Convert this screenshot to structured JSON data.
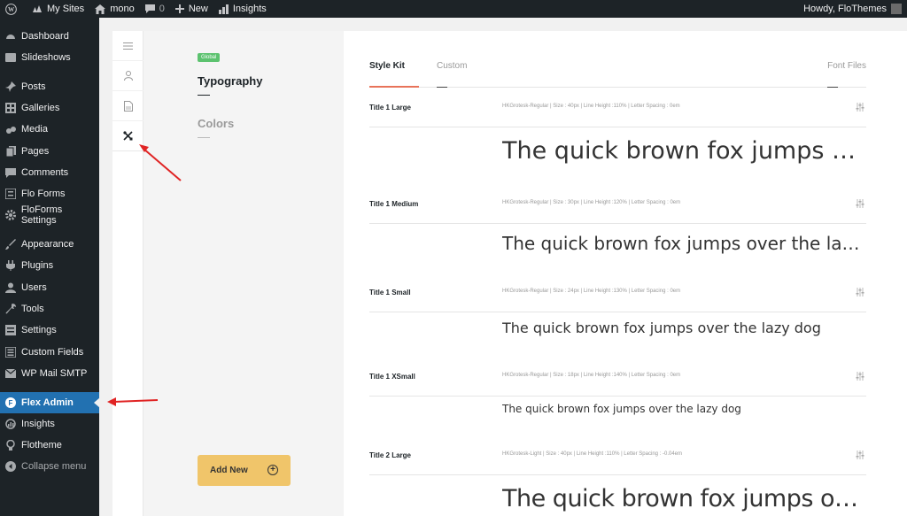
{
  "admin_bar": {
    "my_sites": "My Sites",
    "site_name": "mono",
    "comments_count": "0",
    "new_label": "New",
    "insights_label": "Insights",
    "howdy": "Howdy, FloThemes"
  },
  "sidebar": {
    "items": [
      {
        "label": "Dashboard",
        "icon": "dashboard-icon"
      },
      {
        "label": "Slideshows",
        "icon": "slideshows-icon"
      },
      {
        "label": "Posts",
        "icon": "pin-icon"
      },
      {
        "label": "Galleries",
        "icon": "galleries-icon"
      },
      {
        "label": "Media",
        "icon": "media-icon"
      },
      {
        "label": "Pages",
        "icon": "pages-icon"
      },
      {
        "label": "Comments",
        "icon": "comment-icon"
      },
      {
        "label": "Flo Forms",
        "icon": "form-icon"
      },
      {
        "label": "FloForms Settings",
        "icon": "gear-icon"
      },
      {
        "label": "Appearance",
        "icon": "brush-icon"
      },
      {
        "label": "Plugins",
        "icon": "plug-icon"
      },
      {
        "label": "Users",
        "icon": "user-icon"
      },
      {
        "label": "Tools",
        "icon": "wrench-icon"
      },
      {
        "label": "Settings",
        "icon": "settings-icon"
      },
      {
        "label": "Custom Fields",
        "icon": "fields-icon"
      },
      {
        "label": "WP Mail SMTP",
        "icon": "mail-icon"
      },
      {
        "label": "Flex Admin",
        "icon": "flex-icon",
        "active": true
      },
      {
        "label": "Insights",
        "icon": "insights-icon"
      },
      {
        "label": "Flotheme",
        "icon": "bulb-icon"
      },
      {
        "label": "Collapse menu",
        "icon": "collapse-icon"
      }
    ]
  },
  "panel": {
    "badge": "Global",
    "categories": [
      "Typography",
      "Colors"
    ],
    "add_new": "Add New"
  },
  "tabs": {
    "style_kit": "Style Kit",
    "custom": "Custom",
    "font_files": "Font Files"
  },
  "styles": [
    {
      "name": "Title 1 Large",
      "meta": "HKGrotesk-Regular | Size : 40px | Line Height :110% | Letter Spacing : 0em",
      "sample": "The quick brown fox jumps over the lazy dog"
    },
    {
      "name": "Title 1 Medium",
      "meta": "HKGrotesk-Regular | Size : 30px | Line Height :120% | Letter Spacing : 0em",
      "sample": "The quick brown fox jumps over the lazy dog"
    },
    {
      "name": "Title 1 Small",
      "meta": "HKGrotesk-Regular | Size : 24px | Line Height :130% | Letter Spacing : 0em",
      "sample": "The quick brown fox jumps over the lazy dog"
    },
    {
      "name": "Title 1 XSmall",
      "meta": "HKGrotesk-Regular | Size : 18px | Line Height :140% | Letter Spacing : 0em",
      "sample": "The quick brown fox jumps over the lazy dog"
    },
    {
      "name": "Title 2 Large",
      "meta": "HKGrotesk-Light | Size : 40px | Line Height :110% | Letter Spacing : -0.04em",
      "sample": "The quick brown fox jumps over the lazy dog"
    }
  ],
  "colors": {
    "admin_dark": "#1d2327",
    "active_blue": "#2271b1",
    "accent_orange": "#e8735a",
    "badge_green": "#5cc26f",
    "button_yellow": "#f0c56a",
    "annotation_red": "#e02424"
  }
}
